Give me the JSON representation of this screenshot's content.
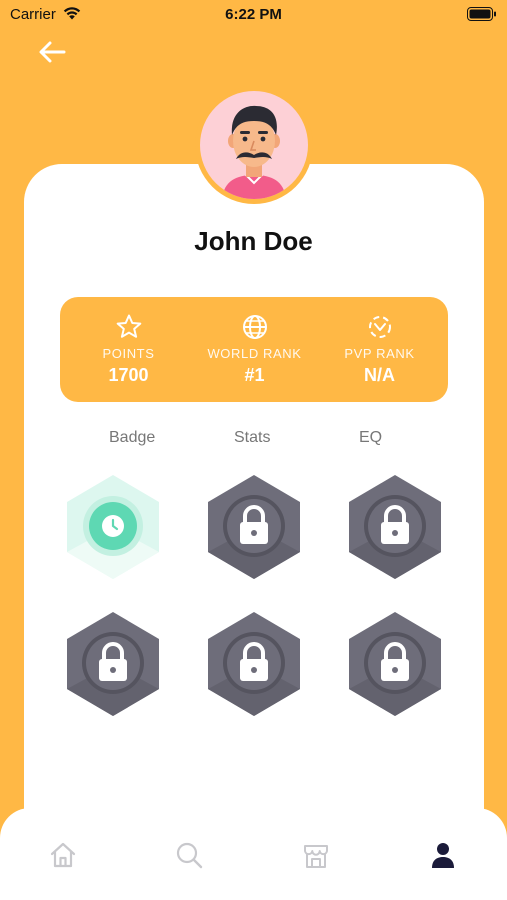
{
  "status_bar": {
    "carrier": "Carrier",
    "time": "6:22 PM"
  },
  "profile": {
    "name": "John Doe"
  },
  "stats": [
    {
      "icon": "star-icon",
      "label": "POINTS",
      "value": "1700"
    },
    {
      "icon": "globe-icon",
      "label": "WORLD RANK",
      "value": "#1"
    },
    {
      "icon": "pvp-rank-icon",
      "label": "PVP RANK",
      "value": "N/A"
    }
  ],
  "tabs": [
    "Badge",
    "Stats",
    "EQ"
  ],
  "badges": [
    {
      "state": "unlocked",
      "icon": "clock-icon"
    },
    {
      "state": "locked",
      "icon": "lock-icon"
    },
    {
      "state": "locked",
      "icon": "lock-icon"
    },
    {
      "state": "locked",
      "icon": "lock-icon"
    },
    {
      "state": "locked",
      "icon": "lock-icon"
    },
    {
      "state": "locked",
      "icon": "lock-icon"
    }
  ],
  "bottom_nav": [
    {
      "icon": "home-icon",
      "active": false
    },
    {
      "icon": "search-icon",
      "active": false
    },
    {
      "icon": "store-icon",
      "active": false
    },
    {
      "icon": "profile-icon",
      "active": true
    }
  ],
  "colors": {
    "background": "#FFB845",
    "card": "#FFFFFF",
    "locked_badge": "#6E6D7A",
    "unlocked_badge": "#5ED8B3",
    "nav_active": "#1B1B3A",
    "nav_inactive": "#C8C8CC"
  }
}
